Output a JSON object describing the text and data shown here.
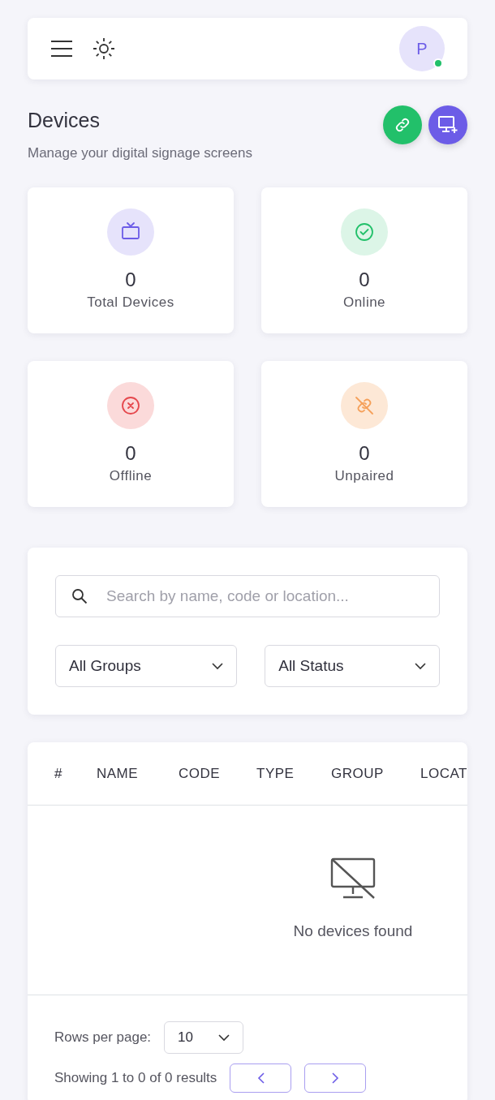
{
  "navbar": {
    "avatar_initial": "P",
    "online": true
  },
  "header": {
    "title": "Devices",
    "subtitle": "Manage your digital signage screens"
  },
  "stats": [
    {
      "kind": "total",
      "value": "0",
      "label": "Total Devices"
    },
    {
      "kind": "online",
      "value": "0",
      "label": "Online"
    },
    {
      "kind": "offline",
      "value": "0",
      "label": "Offline"
    },
    {
      "kind": "unpaired",
      "value": "0",
      "label": "Unpaired"
    }
  ],
  "search": {
    "placeholder": "Search by name, code or location..."
  },
  "filters": [
    {
      "value": "All Groups"
    },
    {
      "value": "All Status"
    }
  ],
  "table": {
    "columns": [
      "#",
      "NAME",
      "CODE",
      "TYPE",
      "GROUP",
      "LOCAT"
    ],
    "empty_message": "No devices found"
  },
  "pagination": {
    "rows_label": "Rows per page:",
    "rows_value": "10",
    "summary": "Showing 1 to 0 of 0 results"
  }
}
